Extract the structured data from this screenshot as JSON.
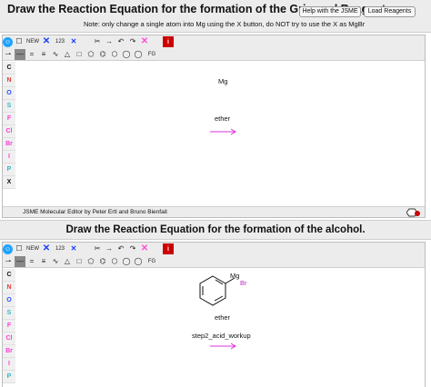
{
  "section1": {
    "title": "Draw the Reaction Equation for the formation of the Grignard Reagent.",
    "note": "Note: only change a single atom into Mg using the X button, do NOT try to use the X as MgBr",
    "help_button": "Help with the JSME",
    "load_button": "Load Reagents"
  },
  "section2": {
    "title": "Draw the Reaction Equation for the formation of the alcohol."
  },
  "toolbar": {
    "new_label": "NEW",
    "numbering_label": "123",
    "fg_label": "FG",
    "info_label": "i"
  },
  "atoms": [
    {
      "symbol": "C",
      "color": "#111111"
    },
    {
      "symbol": "N",
      "color": "#e23a3a"
    },
    {
      "symbol": "O",
      "color": "#2a4bff"
    },
    {
      "symbol": "S",
      "color": "#2fb8c8"
    },
    {
      "symbol": "F",
      "color": "#ff3ad8"
    },
    {
      "symbol": "Cl",
      "color": "#ff3ad8"
    },
    {
      "symbol": "Br",
      "color": "#ff3ad8"
    },
    {
      "symbol": "I",
      "color": "#ff3ad8"
    },
    {
      "symbol": "P",
      "color": "#2fb8c8"
    },
    {
      "symbol": "X",
      "color": "#111111"
    }
  ],
  "editor1": {
    "mg_label": "Mg",
    "ether_label": "ether",
    "status": "JSME Molecular Editor by Peter Ertl and Bruno Bienfait"
  },
  "editor2": {
    "mg_label": "Mg",
    "br_label": "Br",
    "ether_label": "ether",
    "step_label": "step2_acid_workup"
  },
  "colors": {
    "arrow": "#dd33dd",
    "br": "#c02ac0",
    "red_button": "#cc0000",
    "smiley": "#1fa3ff"
  }
}
